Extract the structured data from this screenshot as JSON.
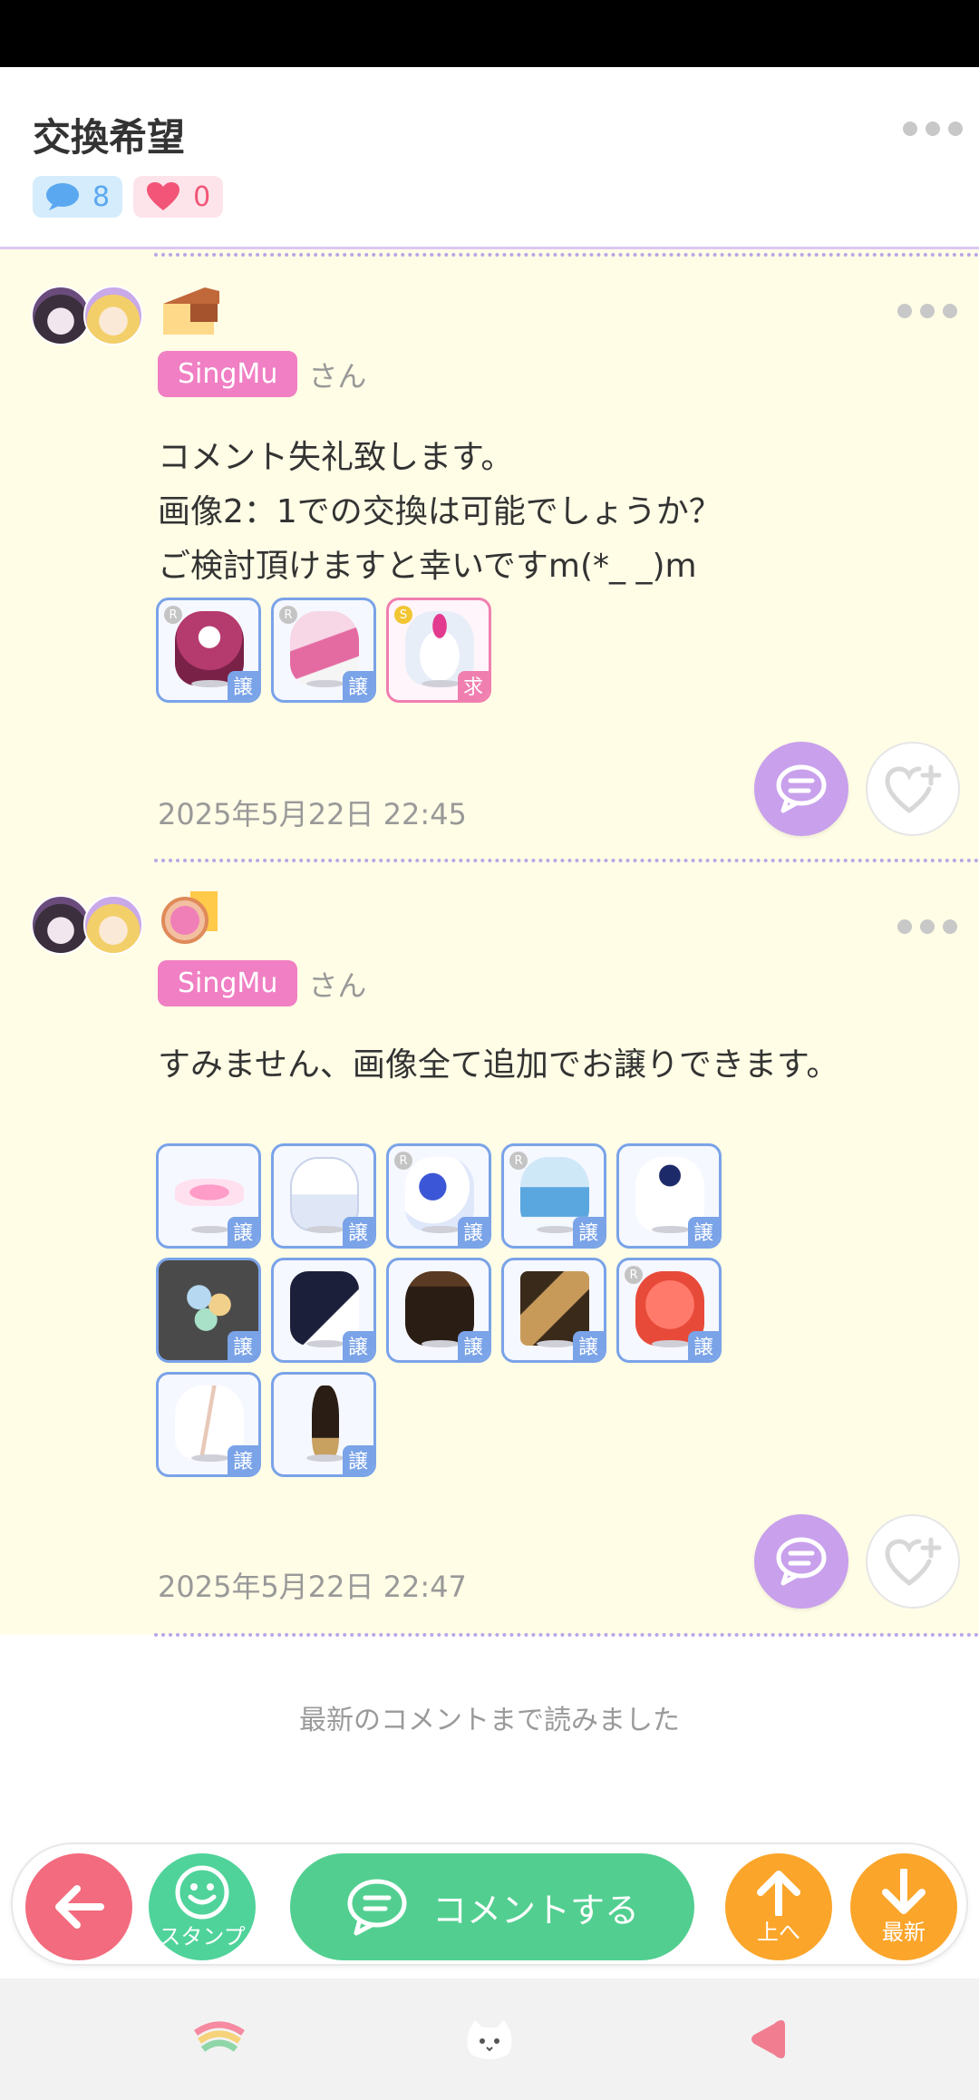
{
  "header": {
    "title": "交換希望",
    "comment_count": "8",
    "like_count": "0"
  },
  "comments": [
    {
      "user": "SingMu",
      "suffix": "さん",
      "lines": [
        "コメント失礼致します。",
        "画像2：1での交換は可能でしょうか？",
        "ご検討頂けますと幸いですm(*_ _)m"
      ],
      "items": [
        {
          "rarity": "R",
          "tag": "譲"
        },
        {
          "rarity": "R",
          "tag": "譲"
        },
        {
          "rarity": "S",
          "tag": "求"
        }
      ],
      "timestamp": "2025年5月22日 22:45"
    },
    {
      "user": "SingMu",
      "suffix": "さん",
      "lines": [
        "すみません、画像全て追加でお譲りできます。"
      ],
      "items": [
        {
          "rarity": "",
          "tag": "譲"
        },
        {
          "rarity": "",
          "tag": "譲"
        },
        {
          "rarity": "R",
          "tag": "譲"
        },
        {
          "rarity": "R",
          "tag": "譲"
        },
        {
          "rarity": "",
          "tag": "譲"
        },
        {
          "rarity": "",
          "tag": "譲"
        },
        {
          "rarity": "",
          "tag": "譲"
        },
        {
          "rarity": "",
          "tag": "譲"
        },
        {
          "rarity": "",
          "tag": "譲"
        },
        {
          "rarity": "R",
          "tag": "譲"
        },
        {
          "rarity": "",
          "tag": "譲"
        },
        {
          "rarity": "",
          "tag": "譲"
        }
      ],
      "timestamp": "2025年5月22日 22:47"
    }
  ],
  "read_all_text": "最新のコメントまで読みました",
  "action_bar": {
    "stamp_label": "スタンプ",
    "comment_label": "コメントする",
    "up_label": "上へ",
    "latest_label": "最新"
  },
  "colors": {
    "comment_bg": "#fffde6",
    "name_tag": "#f07fc4",
    "reply_button": "#c8a0ec",
    "comment_button": "#52cf90",
    "back_button": "#f36b7e",
    "scroll_buttons": "#fba52b"
  },
  "icons": [
    "chat-bubble-icon",
    "heart-icon",
    "more-icon",
    "reply-icon",
    "heart-plus-icon",
    "back-arrow-icon",
    "smile-icon",
    "up-arrow-icon",
    "down-arrow-icon",
    "rainbow-icon",
    "cat-icon",
    "triangle-back-icon"
  ]
}
